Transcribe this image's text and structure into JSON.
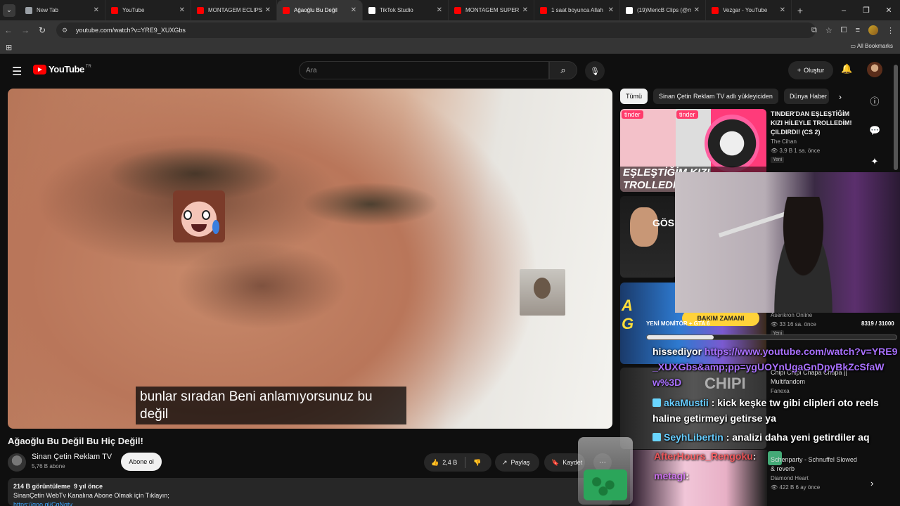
{
  "browser": {
    "tabs": [
      {
        "title": "New Tab",
        "favicon_color": "#9aa0a6",
        "active": false
      },
      {
        "title": "YouTube",
        "favicon_color": "#ff0000",
        "active": false
      },
      {
        "title": "MONTAGEM ECLIPSE",
        "favicon_color": "#ff0000",
        "active": false
      },
      {
        "title": "Ağaoğlu Bu Değil",
        "favicon_color": "#ff0000",
        "active": true
      },
      {
        "title": "TikTok Studio",
        "favicon_color": "#ffffff",
        "active": false
      },
      {
        "title": "MONTAGEM SUPER",
        "favicon_color": "#ff0000",
        "active": false
      },
      {
        "title": "1 saat boyunca Allah",
        "favicon_color": "#ff0000",
        "active": false
      },
      {
        "title": "(19)MericB Clips (@m",
        "favicon_color": "#ffffff",
        "active": false
      },
      {
        "title": "Vezgar - YouTube",
        "favicon_color": "#ff0000",
        "active": false
      }
    ],
    "url": "youtube.com/watch?v=YRE9_XUXGbs",
    "all_bookmarks": "All Bookmarks"
  },
  "yt": {
    "logo_text": "YouTube",
    "country_code": "TR",
    "search_placeholder": "Ara",
    "create_label": "Oluştur"
  },
  "video": {
    "caption_text": "bunlar sıradan Beni anlamıyorsunuz bu değil",
    "title": "Ağaoğlu Bu Değil Bu Hiç Değil!",
    "channel_name": "Sinan Çetin Reklam TV",
    "subscribers": "5,76 B abone",
    "subscribe_label": "Abone ol",
    "likes": "2,4 B",
    "share_label": "Paylaş",
    "save_label": "Kaydet",
    "desc_views": "214 B görüntüleme",
    "desc_date": "9 yıl önce",
    "desc_line": "SinanÇetin WebTv Kanalına Abone Olmak için Tıklayın;",
    "desc_link": "https://goo.gl/CqNqtv"
  },
  "sidebar": {
    "chips": [
      "Tümü",
      "Sinan Çetin Reklam TV adlı yükleyiciden",
      "Dünya Haber"
    ],
    "recs": [
      {
        "title": "TINDER'DAN EŞLEŞTİĞİM KIZI HİLEYLE TROLLEDİM! ÇILDIRDI! (CS 2)",
        "channel": "The Cihan",
        "meta": "3,9 B  1 sa. önce",
        "badge": "Yeni",
        "thumb_text": "EŞLEŞTİĞİM KIZI TROLLEDİM"
      },
      {
        "title": "",
        "channel": "",
        "meta": "",
        "badge": "",
        "thumb_text": "GÖS"
      },
      {
        "title": "",
        "channel": "Asenkron Online",
        "meta": "33  16 sa. önce",
        "badge": "Yeni",
        "thumb_text": "YENİ MONİTÖR + GTA"
      },
      {
        "title": "Chipi Chipi Chapa Chapa || Multifandom",
        "channel": "Fanexa",
        "meta": "",
        "badge": "",
        "thumb_text": "CHIPI"
      },
      {
        "title": "Schenparty - Schnuffel Slowed & reverb",
        "channel": "Diamond Heart",
        "meta": "422 B  6 ay önce",
        "badge": "",
        "thumb_text": ""
      }
    ]
  },
  "overlay": {
    "progress_label": "YENİ MONİTÖR + GTA 6",
    "progress_current": 8319,
    "progress_total": 31000,
    "progress_text": "8319 / 31000",
    "rec_thumb_label": "BAKIM ZAMANI",
    "chat": [
      {
        "user": "",
        "text": "hissediyor",
        "url": "https://www.youtube.com/watch?v=YRE9_XUXGbs&amp;pp=ygUOYnUgaGnDpyBkZcSfaWw%3D"
      },
      {
        "user": "akaMustii",
        "text": ": kick keşke tw gibi clipleri oto reels haline getirmeyi getirse ya",
        "url": ""
      },
      {
        "user": "SeyhLibertin",
        "text": ": analizi daha yeni getirdiler aq",
        "url": ""
      },
      {
        "user": "AfterHours_Rengoku",
        "text": ":",
        "url": ""
      },
      {
        "user": "metagi",
        "text": ":",
        "url": ""
      }
    ]
  },
  "colors": {
    "yt_red": "#ff0000",
    "accent_link": "#3ea6ff",
    "chat_url": "#a970ff"
  }
}
